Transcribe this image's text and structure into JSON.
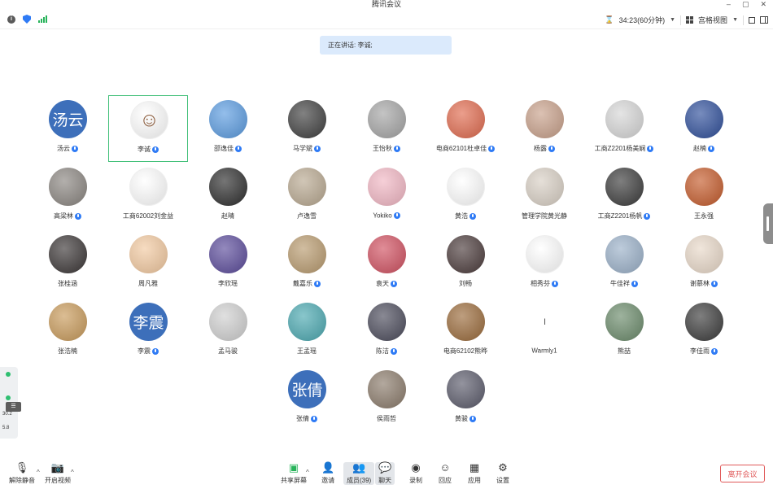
{
  "window": {
    "title": "腾讯会议",
    "min": "–",
    "restore": "▢",
    "close": "✕"
  },
  "topbar": {
    "timer": "34:23(60分钟)",
    "layout_label": "宫格视图"
  },
  "speaking": "正在讲话: 李诚;",
  "participants": [
    {
      "name": "汤云",
      "avatar_text": "汤云",
      "kind": "text",
      "mic": true
    },
    {
      "name": "李诚",
      "kind": "photo",
      "color": "#ffffff",
      "glyph": "☺",
      "mic": true,
      "active": true
    },
    {
      "name": "邵逸佳",
      "kind": "photo",
      "color": "#5a9be0",
      "glyph": "",
      "mic": true
    },
    {
      "name": "马学斌",
      "kind": "photo",
      "color": "#3e3e3e",
      "glyph": "",
      "mic": true
    },
    {
      "name": "王怡秋",
      "kind": "photo",
      "color": "#a4a4a4",
      "glyph": "",
      "mic": true
    },
    {
      "name": "电商62101杜卓佳",
      "kind": "photo",
      "color": "#e06a4e",
      "glyph": "",
      "mic": true
    },
    {
      "name": "杨露",
      "kind": "photo",
      "color": "#c8a08a",
      "glyph": "",
      "mic": true
    },
    {
      "name": "工商Z2201杨美娴",
      "kind": "photo",
      "color": "#d6d6d6",
      "glyph": "",
      "mic": true
    },
    {
      "name": "赵楠",
      "kind": "photo",
      "color": "#2e4e9a",
      "glyph": "",
      "mic": true
    },
    {
      "name": "高梁林",
      "kind": "photo",
      "color": "#8a8580",
      "glyph": "",
      "mic": true
    },
    {
      "name": "工商62002刘金益",
      "kind": "photo",
      "color": "#ffffff",
      "glyph": "",
      "mic": false
    },
    {
      "name": "赵晴",
      "kind": "photo",
      "color": "#2c2c2c",
      "glyph": "",
      "mic": false
    },
    {
      "name": "卢逸雪",
      "kind": "photo",
      "color": "#b8a890",
      "glyph": "",
      "mic": false
    },
    {
      "name": "Yokiko",
      "kind": "photo",
      "color": "#f1b6c3",
      "glyph": "",
      "mic": true
    },
    {
      "name": "黄浩",
      "kind": "photo",
      "color": "#ffffff",
      "glyph": "",
      "mic": true
    },
    {
      "name": "管理学院黄光静",
      "kind": "photo",
      "color": "#d8cfc4",
      "glyph": "",
      "mic": false
    },
    {
      "name": "工商Z2201杨帆",
      "kind": "photo",
      "color": "#3a3a3a",
      "glyph": "",
      "mic": true
    },
    {
      "name": "王永强",
      "kind": "photo",
      "color": "#c45a2a",
      "glyph": "",
      "mic": false
    },
    {
      "name": "张桂涵",
      "kind": "photo",
      "color": "#3a3535",
      "glyph": "",
      "mic": false
    },
    {
      "name": "周凡雅",
      "kind": "photo",
      "color": "#f2c9a0",
      "glyph": "",
      "mic": false
    },
    {
      "name": "李欣瑶",
      "kind": "photo",
      "color": "#5a4a9a",
      "glyph": "",
      "mic": false
    },
    {
      "name": "戴嘉乐",
      "kind": "photo",
      "color": "#b89a6e",
      "glyph": "",
      "mic": true
    },
    {
      "name": "袁天",
      "kind": "photo",
      "color": "#d05060",
      "glyph": "",
      "mic": true
    },
    {
      "name": "刘畅",
      "kind": "photo",
      "color": "#4a3a3a",
      "glyph": "",
      "mic": false
    },
    {
      "name": "相秀芬",
      "kind": "photo",
      "color": "#ffffff",
      "glyph": "",
      "mic": true
    },
    {
      "name": "牛佳祥",
      "kind": "photo",
      "color": "#9ab0c8",
      "glyph": "",
      "mic": true
    },
    {
      "name": "谢慕林",
      "kind": "photo",
      "color": "#e8d8c8",
      "glyph": "",
      "mic": true
    },
    {
      "name": "张浩楠",
      "kind": "photo",
      "color": "#c89a5a",
      "glyph": "",
      "mic": false
    },
    {
      "name": "李震",
      "avatar_text": "李震",
      "kind": "text",
      "mic": true
    },
    {
      "name": "孟马骏",
      "kind": "photo",
      "color": "#cfcfcf",
      "glyph": "",
      "mic": false
    },
    {
      "name": "王孟瑶",
      "kind": "photo",
      "color": "#4aa8b0",
      "glyph": "",
      "mic": false
    },
    {
      "name": "陈洁",
      "kind": "photo",
      "color": "#4a4a5a",
      "glyph": "",
      "mic": true
    },
    {
      "name": "电商62102熊晔",
      "kind": "photo",
      "color": "#9a6a3a",
      "glyph": "",
      "mic": false
    },
    {
      "name": "Warmly1",
      "avatar_text": "I",
      "kind": "line",
      "mic": false
    },
    {
      "name": "熊喆",
      "kind": "photo",
      "color": "#6a8a6a",
      "glyph": "",
      "mic": false
    },
    {
      "name": "李佳雨",
      "kind": "photo",
      "color": "#3a3a3a",
      "glyph": "",
      "mic": true
    },
    {
      "name": "张倩",
      "avatar_text": "张倩",
      "kind": "text",
      "mic": true
    },
    {
      "name": "侯雨哲",
      "kind": "photo",
      "color": "#8a7a6a",
      "glyph": "",
      "mic": false
    },
    {
      "name": "黄骏",
      "kind": "photo",
      "color": "#5a5a6a",
      "glyph": "",
      "mic": true
    }
  ],
  "left_panel": {
    "val1": "30.2",
    "val2": "5.8",
    "list_icon": "☰"
  },
  "bottombar": {
    "unmute": "解除静音",
    "video": "开启视频",
    "share": "共享屏幕",
    "invite": "邀请",
    "members": "成员(39)",
    "chat": "聊天",
    "record": "录制",
    "react": "回应",
    "apps": "应用",
    "settings": "设置",
    "leave": "离开会议"
  }
}
